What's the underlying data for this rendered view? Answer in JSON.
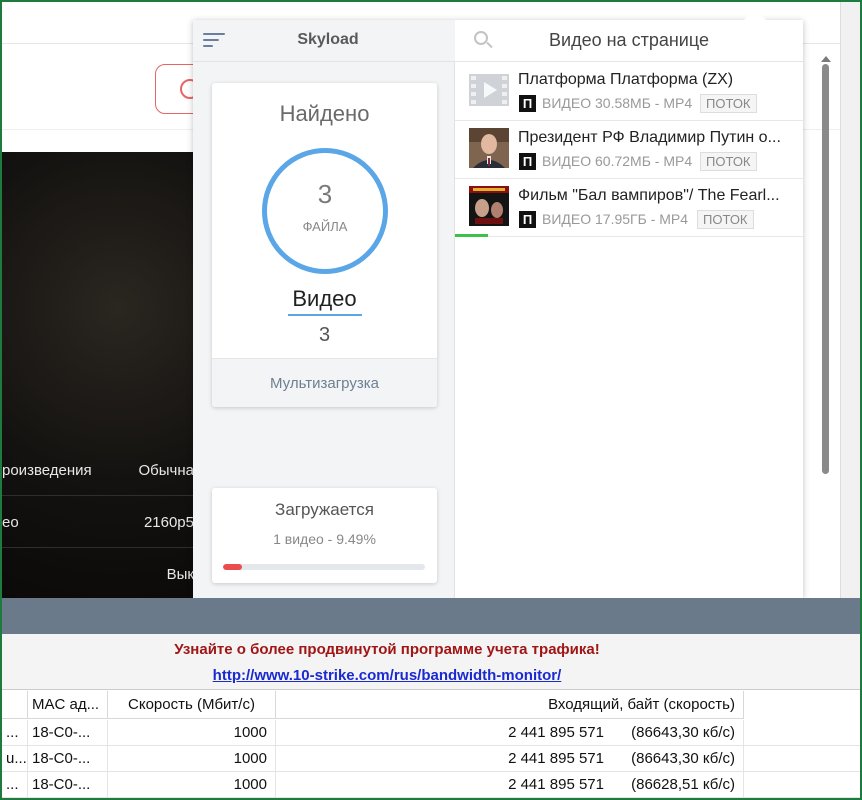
{
  "background_page": {
    "rows": [
      {
        "left": "роизведения",
        "right": "Обычна"
      },
      {
        "left": "ео",
        "right": "2160р5"
      },
      {
        "left": "",
        "right": "Вык"
      }
    ]
  },
  "popup": {
    "brand": "Skyload",
    "found": {
      "title": "Найдено",
      "count": "3",
      "count_label": "ФАЙЛА",
      "type_name": "Видео",
      "type_count": "3",
      "multi_button": "Мультизагрузка"
    },
    "download": {
      "title": "Загружается",
      "subtitle": "1 видео - 9.49%",
      "progress_fraction": 0.0949
    },
    "videos_header": "Видео на странице",
    "videos": [
      {
        "title": "Платформа Платформа (ZX)",
        "badge": "П",
        "meta": "ВИДЕО 30.58МБ - MP4",
        "stream": "ПОТОК",
        "thumb": "video-placeholder-icon"
      },
      {
        "title": "Президент РФ Владимир Путин о...",
        "badge": "П",
        "meta": "ВИДЕО 60.72МБ - MP4",
        "stream": "ПОТОК",
        "thumb": "portrait-thumbnail"
      },
      {
        "title": "Фильм \"Бал вампиров\"/ The Fearl...",
        "badge": "П",
        "meta": "ВИДЕО 17.95ГБ - MP4",
        "stream": "ПОТОК",
        "thumb": "movie-poster-thumbnail",
        "row_progress_fraction": 0.0949
      }
    ]
  },
  "promo": {
    "text": "Узнайте о более продвинутой программе учета трафика!",
    "link": "http://www.10-strike.com/rus/bandwidth-monitor/"
  },
  "table": {
    "headers": [
      "",
      "MAC ад...",
      "Скорость (Мбит/с)",
      "Входящий, байт (скорость)"
    ],
    "rows": [
      [
        "...",
        "18-C0-...",
        "1000",
        "2 441 895 571",
        "(86643,30 кб/с)"
      ],
      [
        "u...",
        "18-C0-...",
        "1000",
        "2 441 895 571",
        "(86643,30 кб/с)"
      ],
      [
        "...",
        "18-C0-...",
        "1000",
        "2 441 895 571",
        "(86628,51 кб/с)"
      ]
    ]
  },
  "colors": {
    "ring": "#5aa6e6",
    "progress": "#ea4d4d",
    "row_progress": "#3cc24a",
    "promo_text": "#a01616",
    "promo_link": "#1a2ad0"
  }
}
